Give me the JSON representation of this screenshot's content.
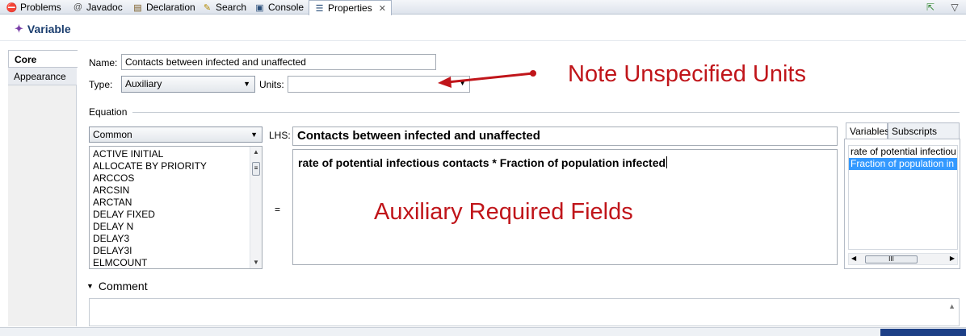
{
  "tabs": [
    {
      "label": "Problems",
      "icon": "problems-icon",
      "glyph": "⛔"
    },
    {
      "label": "Javadoc",
      "icon": "javadoc-icon",
      "glyph": "@"
    },
    {
      "label": "Declaration",
      "icon": "declaration-icon",
      "glyph": "▤"
    },
    {
      "label": "Search",
      "icon": "search-icon",
      "glyph": "✎"
    },
    {
      "label": "Console",
      "icon": "console-icon",
      "glyph": "▣"
    },
    {
      "label": "Properties",
      "icon": "properties-icon",
      "glyph": "☰",
      "active": true
    }
  ],
  "header": {
    "title": "Variable",
    "icon": "variable-icon"
  },
  "side_tabs": {
    "core": "Core",
    "appearance": "Appearance"
  },
  "form": {
    "name_label": "Name:",
    "name_value": "Contacts between infected and unaffected",
    "type_label": "Type:",
    "type_value": "Auxiliary",
    "units_label": "Units:",
    "units_value": "",
    "equation_label": "Equation",
    "category_value": "Common",
    "lhs_label": "LHS:",
    "lhs_value": "Contacts between infected and unaffected",
    "equals_label": "=",
    "equation_value": "rate of potential infectious contacts * Fraction of population infected",
    "functions": [
      "ACTIVE INITIAL",
      "ALLOCATE BY PRIORITY",
      "ARCCOS",
      "ARCSIN",
      "ARCTAN",
      "DELAY FIXED",
      "DELAY N",
      "DELAY3",
      "DELAY3I",
      "ELMCOUNT"
    ]
  },
  "variables_panel": {
    "tab_variables": "Variables",
    "tab_subscripts": "Subscripts",
    "items": [
      "rate of potential infectiou",
      "Fraction of population in"
    ],
    "selected_index": 1,
    "scroll_thumb": "III"
  },
  "comment": {
    "label": "Comment"
  },
  "annotations": {
    "units_note": "Note Unspecified Units",
    "fields_note": "Auxiliary Required Fields"
  },
  "colors": {
    "annotation": "#c0151a",
    "selection": "#3399ff",
    "header_title": "#1a3d6e"
  }
}
